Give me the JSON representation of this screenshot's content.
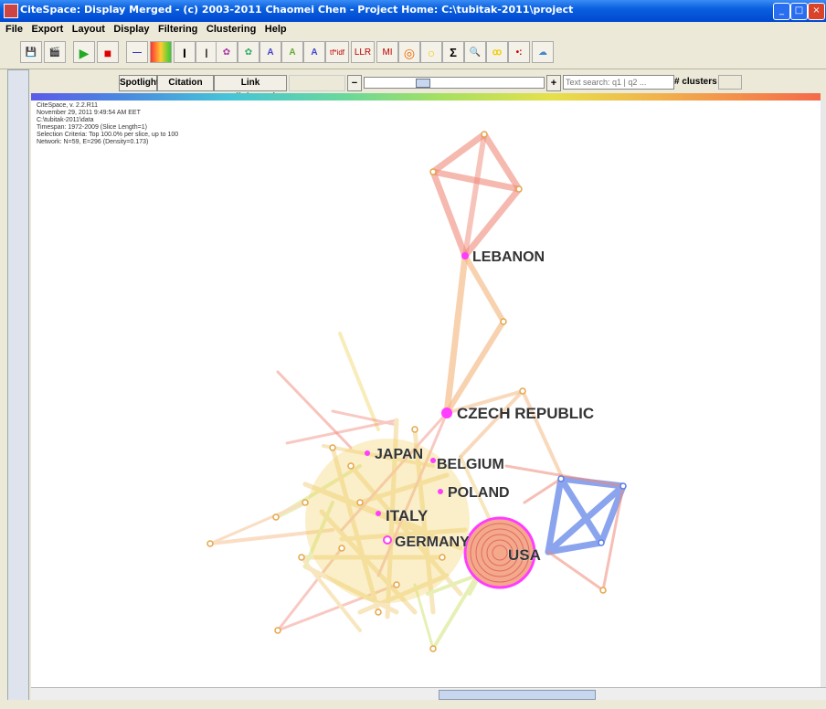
{
  "window": {
    "title": "CiteSpace: Display Merged - (c) 2003-2011 Chaomei Chen - Project Home: C:\\tubitak-2011\\project",
    "controls": [
      "_",
      "□",
      "×"
    ]
  },
  "menu": [
    "File",
    "Export",
    "Layout",
    "Display",
    "Filtering",
    "Clustering",
    "Help"
  ],
  "toolbar": {
    "items": [
      {
        "name": "save-icon",
        "glyph": "💾"
      },
      {
        "name": "movie-icon",
        "glyph": "🎬"
      },
      {
        "name": "play-icon",
        "glyph": "▶"
      },
      {
        "name": "stop-icon",
        "glyph": "■"
      },
      {
        "name": "line-icon",
        "glyph": "—"
      },
      {
        "name": "heatmap-icon",
        "glyph": "▦"
      },
      {
        "name": "timeline-icon",
        "glyph": "I"
      },
      {
        "name": "text-cursor-icon",
        "glyph": "I"
      },
      {
        "name": "cluster-view-icon",
        "glyph": "✿"
      },
      {
        "name": "cluster-view2-icon",
        "glyph": "✿"
      },
      {
        "name": "tree-icon-1",
        "glyph": "A"
      },
      {
        "name": "tree-icon-2",
        "glyph": "A"
      },
      {
        "name": "tree-icon-3",
        "glyph": "A"
      },
      {
        "name": "tfidf-button",
        "glyph": "tf*idf"
      },
      {
        "name": "llr-button",
        "glyph": "LLR"
      },
      {
        "name": "mi-button",
        "glyph": "MI"
      },
      {
        "name": "circle-target-icon",
        "glyph": "◎"
      },
      {
        "name": "circle-yellow-icon",
        "glyph": "○"
      },
      {
        "name": "sigma-icon",
        "glyph": "Σ"
      },
      {
        "name": "search-yellow-icon",
        "glyph": "🔍"
      },
      {
        "name": "nodes-yellow-icon",
        "glyph": "ꝏ"
      },
      {
        "name": "nodes-color-icon",
        "glyph": "•:"
      },
      {
        "name": "wordcloud-icon",
        "glyph": "☁"
      }
    ]
  },
  "panel": {
    "spotlight": "Spotlight",
    "citation_burst": "Citation Burst",
    "link_walkthrough": "Link Walkthrough",
    "text_search_placeholder": "Text search: q1 | q2 ...",
    "clusters_label": "# clusters",
    "zoom_out": "−",
    "zoom_in": "+"
  },
  "info": [
    "CiteSpace, v. 2.2.R11",
    "November 29, 2011 9:49:54 AM EET",
    "C:\\tubitak-2011\\data",
    "Timespan: 1972-2009 (Slice Length=1)",
    "Selection Criteria: Top 100.0% per slice, up to 100",
    "Network: N=59, E=296 (Density=0.173)"
  ],
  "nodes": [
    "LEBANON",
    "CZECH REPUBLIC",
    "JAPAN",
    "BELGIUM",
    "POLAND",
    "ITALY",
    "GERMANY",
    "USA"
  ],
  "colors": {
    "node_highlight": "#ff3cff",
    "label": "#333333"
  }
}
